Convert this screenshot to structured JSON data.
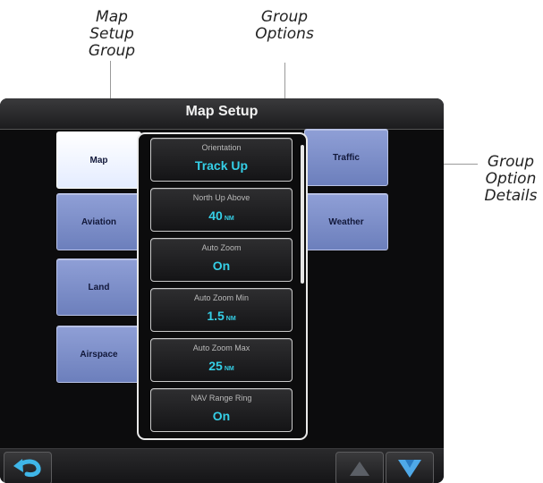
{
  "callouts": {
    "map_setup_group": [
      "Map",
      "Setup",
      "Group"
    ],
    "group_options": [
      "Group",
      "Options"
    ],
    "group_option_details": [
      "Group",
      "Option",
      "Details"
    ]
  },
  "screen": {
    "title": "Map Setup",
    "left_tabs": [
      "Map",
      "Aviation",
      "Land",
      "Airspace"
    ],
    "right_tabs": [
      "Traffic",
      "Weather"
    ],
    "active_tab": "Map",
    "options": [
      {
        "label": "Orientation",
        "value": "Track Up",
        "unit": ""
      },
      {
        "label": "North Up Above",
        "value": "40",
        "unit": "NM"
      },
      {
        "label": "Auto Zoom",
        "value": "On",
        "unit": ""
      },
      {
        "label": "Auto Zoom Min",
        "value": "1.5",
        "unit": "NM"
      },
      {
        "label": "Auto Zoom Max",
        "value": "25",
        "unit": "NM"
      },
      {
        "label": "NAV Range Ring",
        "value": "On",
        "unit": ""
      }
    ],
    "bottom_buttons": [
      "back-icon",
      "scroll-up-icon",
      "scroll-down-icon"
    ]
  },
  "colors": {
    "screen_bg": "#0c0c0d",
    "tab_blue": "#7f90cc",
    "tab_active": "#ffffff",
    "value_cyan": "#35cfe7",
    "back_icon": "#3fb6e8",
    "down_arrow": "#4fa9e8"
  }
}
